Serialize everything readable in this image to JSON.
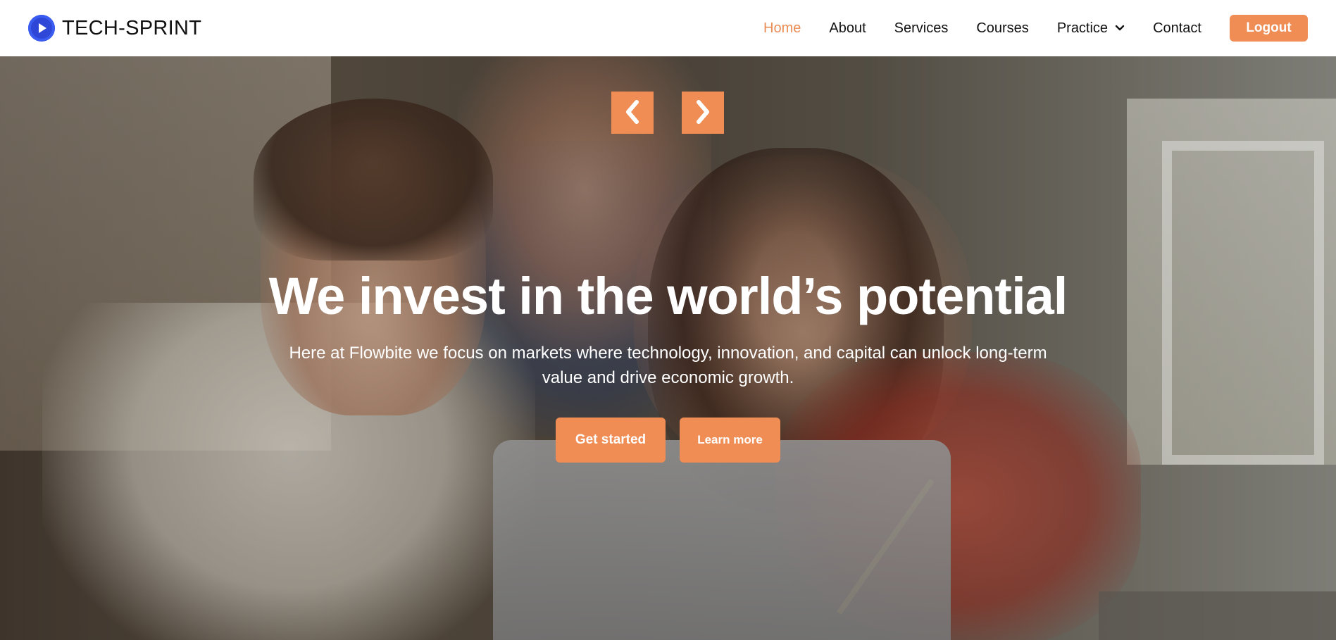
{
  "navbar": {
    "brand": {
      "name": "TECH-SPRINT",
      "icon": "play-logo-icon"
    },
    "links": [
      {
        "label": "Home",
        "active": true
      },
      {
        "label": "About"
      },
      {
        "label": "Services"
      },
      {
        "label": "Courses"
      },
      {
        "label": "Practice",
        "dropdown": true
      },
      {
        "label": "Contact"
      }
    ],
    "logout_label": "Logout"
  },
  "hero": {
    "title": "We invest in the world’s potential",
    "text": "Here at Flowbite we focus on markets where technology, innovation, and capital can unlock long-term value and drive economic growth.",
    "primary_cta": "Get started",
    "secondary_cta": "Learn more",
    "arrows": {
      "prev_icon": "chevron-left-icon",
      "next_icon": "chevron-right-icon"
    }
  },
  "colors": {
    "accent": "#ef8d55",
    "active_link": "#e98c55",
    "brand_logo": "#2f47d6"
  }
}
